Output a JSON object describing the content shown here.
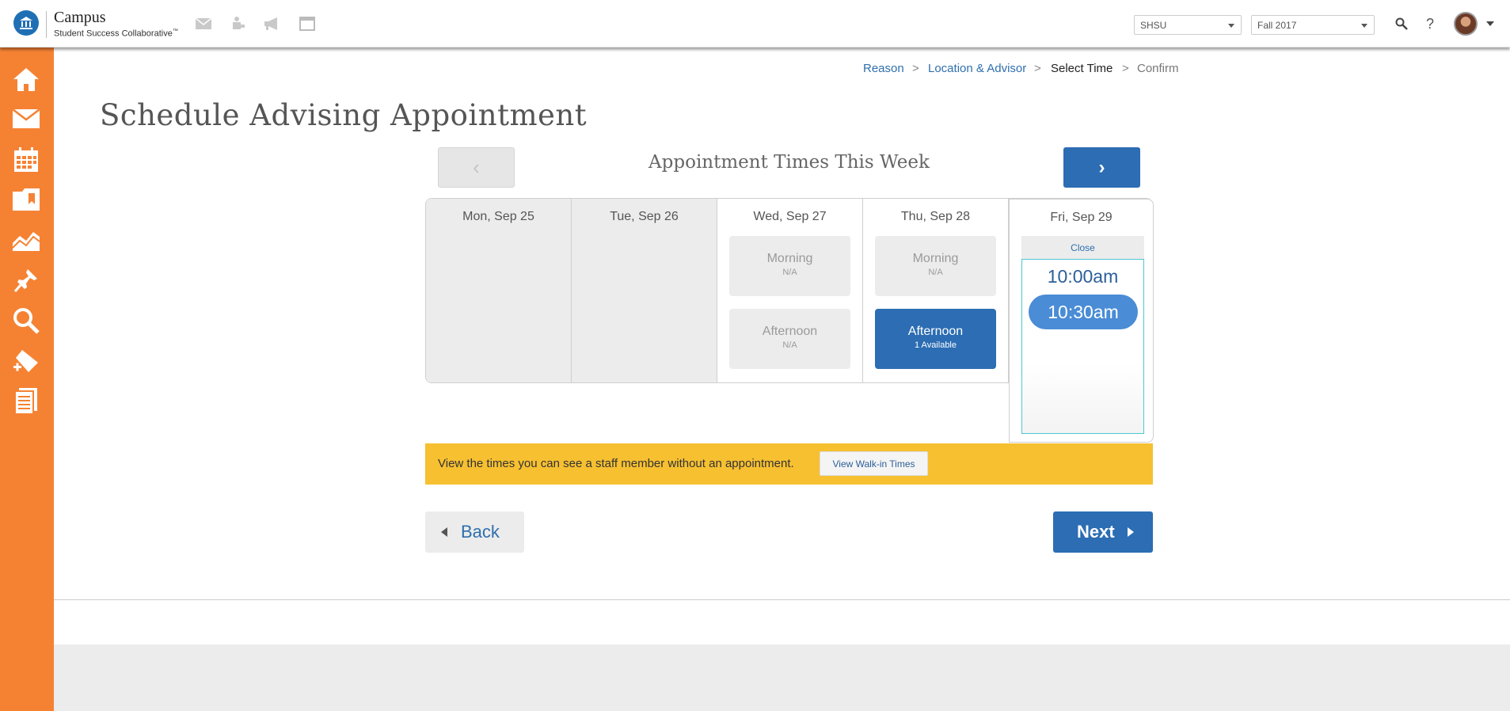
{
  "header": {
    "brand_title": "Campus",
    "brand_subtitle": "Student Success Collaborative",
    "brand_tm": "™",
    "institution_select": "SHSU",
    "term_select": "Fall 2017",
    "help_label": "?"
  },
  "sidebar": {
    "items": [
      "home-icon",
      "mail-icon",
      "calendar-icon",
      "folder-icon",
      "analytics-icon",
      "pin-icon",
      "search-icon",
      "add-tag-icon",
      "notes-icon"
    ]
  },
  "breadcrumb": {
    "step1": "Reason",
    "step2": "Location & Advisor",
    "step3": "Select Time",
    "step4": "Confirm",
    "separator": ">"
  },
  "page": {
    "title": "Schedule Advising Appointment"
  },
  "week": {
    "title": "Appointment Times This Week",
    "prev_symbol": "‹",
    "next_symbol": "›"
  },
  "days": [
    {
      "label": "Mon, Sep 25"
    },
    {
      "label": "Tue, Sep 26"
    },
    {
      "label": "Wed, Sep 27",
      "morning": "Morning",
      "morning_status": "N/A",
      "afternoon": "Afternoon",
      "afternoon_status": "N/A"
    },
    {
      "label": "Thu, Sep 28",
      "morning": "Morning",
      "morning_status": "N/A",
      "afternoon": "Afternoon",
      "afternoon_status": "1 Available"
    },
    {
      "label": "Fri, Sep 29",
      "close": "Close",
      "times": [
        "10:00am",
        "10:30am"
      ]
    }
  ],
  "walkin": {
    "text": "View the times you can see a staff member without an appointment.",
    "button": "View Walk-in Times"
  },
  "nav": {
    "back": "Back",
    "next": "Next"
  },
  "colors": {
    "sidebar": "#f58233",
    "primary": "#2c6db3",
    "selected_time": "#4a8cd6",
    "walkin_banner": "#f7c031"
  }
}
